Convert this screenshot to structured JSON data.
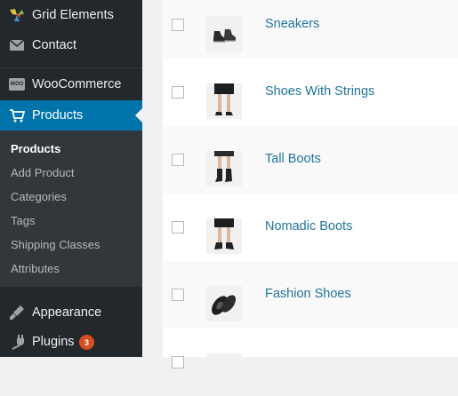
{
  "sidebar": {
    "items": [
      {
        "label": "Grid Elements",
        "icon": "grid-elements-icon"
      },
      {
        "label": "Contact",
        "icon": "envelope-icon"
      },
      {
        "label": "WooCommerce",
        "icon": "woocommerce-icon"
      },
      {
        "label": "Products",
        "icon": "cart-icon"
      },
      {
        "label": "Appearance",
        "icon": "paintbrush-icon"
      },
      {
        "label": "Plugins",
        "icon": "plug-icon"
      }
    ],
    "woo_icon_text": "WOO",
    "plugins_badge": "3",
    "submenu": [
      "Products",
      "Add Product",
      "Categories",
      "Tags",
      "Shipping Classes",
      "Attributes"
    ]
  },
  "products": [
    {
      "name": "Sneakers",
      "thumb": "sneakers"
    },
    {
      "name": "Shoes With Strings",
      "thumb": "legs-shorts"
    },
    {
      "name": "Tall Boots",
      "thumb": "legs-boots"
    },
    {
      "name": "Nomadic Boots",
      "thumb": "legs-dark"
    },
    {
      "name": "Fashion Shoes",
      "thumb": "shoes-pair"
    }
  ],
  "colors": {
    "accent": "#0073aa",
    "link": "#21759b",
    "badge": "#d54e21",
    "sidebar": "#23282d"
  }
}
